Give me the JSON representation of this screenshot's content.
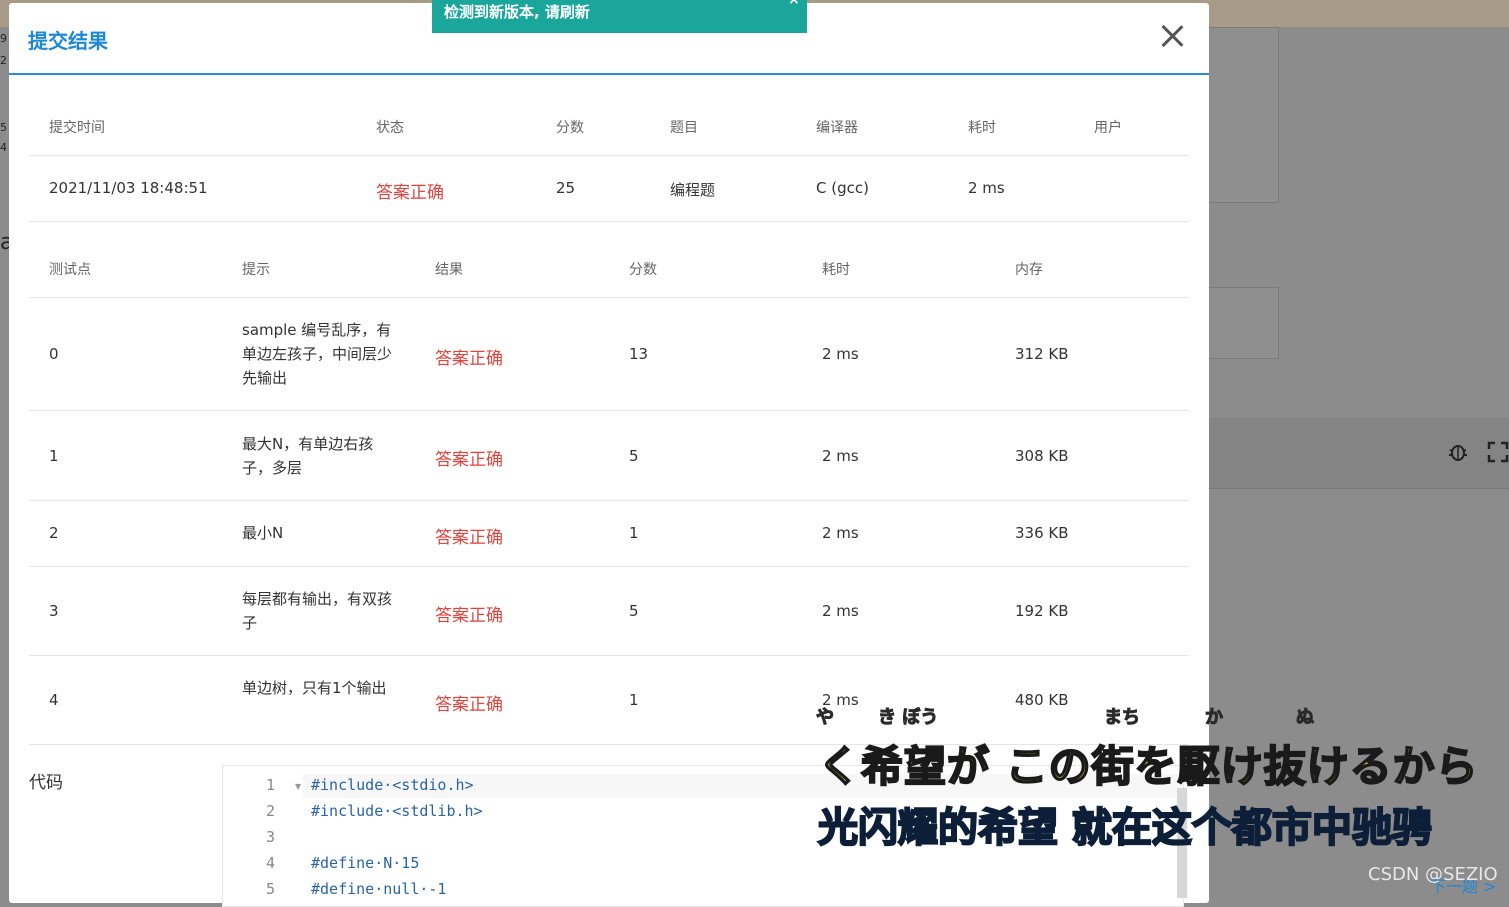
{
  "toast": {
    "message": "检测到新版本, 请刷新",
    "close": "×"
  },
  "modal": {
    "title": "提交结果"
  },
  "submission": {
    "headers": [
      "提交时间",
      "状态",
      "分数",
      "题目",
      "编译器",
      "耗时",
      "用户"
    ],
    "row": {
      "time": "2021/11/03 18:48:51",
      "status": "答案正确",
      "score": "25",
      "problem": "编程题",
      "compiler": "C (gcc)",
      "elapsed": "2 ms",
      "user": ""
    }
  },
  "tests": {
    "headers": [
      "测试点",
      "提示",
      "结果",
      "分数",
      "耗时",
      "内存"
    ],
    "rows": [
      {
        "id": "0",
        "hint": "sample 编号乱序，有单边左孩子，中间层少先输出",
        "result": "答案正确",
        "score": "13",
        "time": "2 ms",
        "memory": "312 KB"
      },
      {
        "id": "1",
        "hint": "最大N，有单边右孩子，多层",
        "result": "答案正确",
        "score": "5",
        "time": "2 ms",
        "memory": "308 KB"
      },
      {
        "id": "2",
        "hint": "最小N",
        "result": "答案正确",
        "score": "1",
        "time": "2 ms",
        "memory": "336 KB"
      },
      {
        "id": "3",
        "hint": "每层都有输出，有双孩子",
        "result": "答案正确",
        "score": "5",
        "time": "2 ms",
        "memory": "192 KB"
      },
      {
        "id": "4",
        "hint": "单边树，只有1个输出",
        "result": "答案正确",
        "score": "1",
        "time": "2 ms",
        "memory": "480 KB"
      }
    ]
  },
  "code": {
    "label": "代码",
    "lines": [
      {
        "num": "1",
        "text": "#include·<stdio.h>"
      },
      {
        "num": "2",
        "text": "#include·<stdlib.h>"
      },
      {
        "num": "3",
        "text": ""
      },
      {
        "num": "4",
        "text": "#define·N·15"
      },
      {
        "num": "5",
        "text": "#define·null·-1"
      }
    ]
  },
  "overlay": {
    "ruby": [
      "や",
      "き ぼう",
      "まち",
      "か",
      "ぬ"
    ],
    "subtitle_jp": "く希望が この街を駆け抜けるから",
    "subtitle_cn": "光闪耀的希望 就在这个都市中驰骋",
    "watermark": "CSDN @SEZIO",
    "next_link": "下一题 >"
  },
  "background": {
    "icons": [
      "bug-icon",
      "fullscreen-icon"
    ]
  }
}
